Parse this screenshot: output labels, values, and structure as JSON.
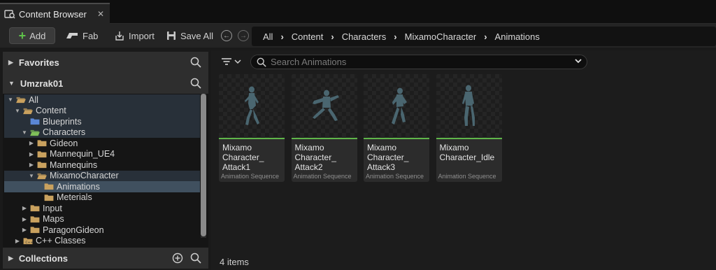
{
  "window": {
    "tab_title": "Content Browser",
    "tab_close": "✕",
    "tab_icon": "content-browser-icon"
  },
  "toolbar": {
    "add_label": "Add",
    "fab_label": "Fab",
    "import_label": "Import",
    "save_all_label": "Save All",
    "back_icon": "back-arrow-icon",
    "forward_icon": "forward-arrow-icon"
  },
  "breadcrumb": [
    "All",
    "Content",
    "Characters",
    "MixamoCharacter",
    "Animations"
  ],
  "left_panel": {
    "favorites_label": "Favorites",
    "project_label": "Umzrak01",
    "collections_label": "Collections",
    "tree": [
      {
        "label": "All",
        "depth": 0,
        "expanded": true,
        "icon": "folder-open",
        "state": "hl"
      },
      {
        "label": "Content",
        "depth": 1,
        "expanded": true,
        "icon": "folder-open",
        "state": "hl"
      },
      {
        "label": "Blueprints",
        "depth": 2,
        "expanded": null,
        "icon": "folder-blue",
        "state": "hl"
      },
      {
        "label": "Characters",
        "depth": 2,
        "expanded": true,
        "icon": "folder-green",
        "state": "hl"
      },
      {
        "label": "Gideon",
        "depth": 3,
        "expanded": false,
        "icon": "folder",
        "state": ""
      },
      {
        "label": "Mannequin_UE4",
        "depth": 3,
        "expanded": false,
        "icon": "folder",
        "state": ""
      },
      {
        "label": "Mannequins",
        "depth": 3,
        "expanded": false,
        "icon": "folder",
        "state": ""
      },
      {
        "label": "MixamoCharacter",
        "depth": 3,
        "expanded": true,
        "icon": "folder-open",
        "state": "hl"
      },
      {
        "label": "Animations",
        "depth": 4,
        "expanded": null,
        "icon": "folder",
        "state": "sel"
      },
      {
        "label": "Meterials",
        "depth": 4,
        "expanded": null,
        "icon": "folder",
        "state": ""
      },
      {
        "label": "Input",
        "depth": 2,
        "expanded": false,
        "icon": "folder",
        "state": ""
      },
      {
        "label": "Maps",
        "depth": 2,
        "expanded": false,
        "icon": "folder",
        "state": ""
      },
      {
        "label": "ParagonGideon",
        "depth": 2,
        "expanded": false,
        "icon": "folder",
        "state": ""
      },
      {
        "label": "C++ Classes",
        "depth": 1,
        "expanded": false,
        "icon": "folder-cpp",
        "state": ""
      }
    ]
  },
  "content": {
    "search_placeholder": "Search Animations",
    "item_count": "4 items",
    "assets": [
      {
        "name": "Mixamo\nCharacter_\nAttack1",
        "type": "Animation Sequence",
        "pose": "attack1"
      },
      {
        "name": "Mixamo\nCharacter_\nAttack2",
        "type": "Animation Sequence",
        "pose": "attack2"
      },
      {
        "name": "Mixamo\nCharacter_\nAttack3",
        "type": "Animation Sequence",
        "pose": "attack3"
      },
      {
        "name": "Mixamo\nCharacter_Idle",
        "type": "Animation Sequence",
        "pose": "idle"
      }
    ]
  },
  "colors": {
    "accent_green": "#5fb64a",
    "selected_row": "#40505f",
    "folder_tan": "#c9a15e",
    "folder_blue": "#5a86d6",
    "folder_green": "#7fbf59"
  }
}
